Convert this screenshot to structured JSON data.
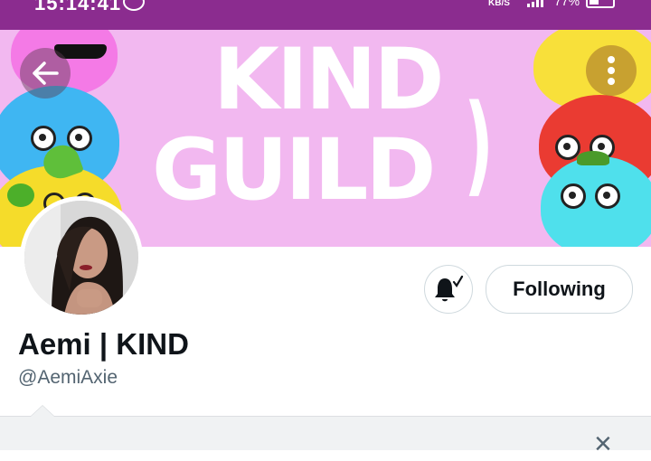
{
  "status_bar": {
    "time": "15:14:41",
    "network_speed_unit": "KB/S",
    "battery_percent": "77%",
    "icons": [
      "chat-bubble-icon",
      "signal-icon",
      "battery-icon"
    ]
  },
  "header": {
    "banner_text_line1": "KIND",
    "banner_text_line2": "GUILD",
    "back_icon": "arrow-left-icon",
    "more_icon": "vertical-ellipsis-icon",
    "banner_color": "#f2b8f0"
  },
  "profile": {
    "display_name": "Aemi | KIND",
    "handle": "@AemiAxie",
    "notification_icon": "bell-subscribed-icon",
    "following_label": "Following"
  },
  "bottom_panel": {
    "close_icon": "close-icon",
    "close_symbol": "×"
  },
  "colors": {
    "status_bar": "#8b2c8f",
    "text_primary": "#0f1419",
    "text_secondary": "#536471",
    "border": "#cfd9de"
  }
}
